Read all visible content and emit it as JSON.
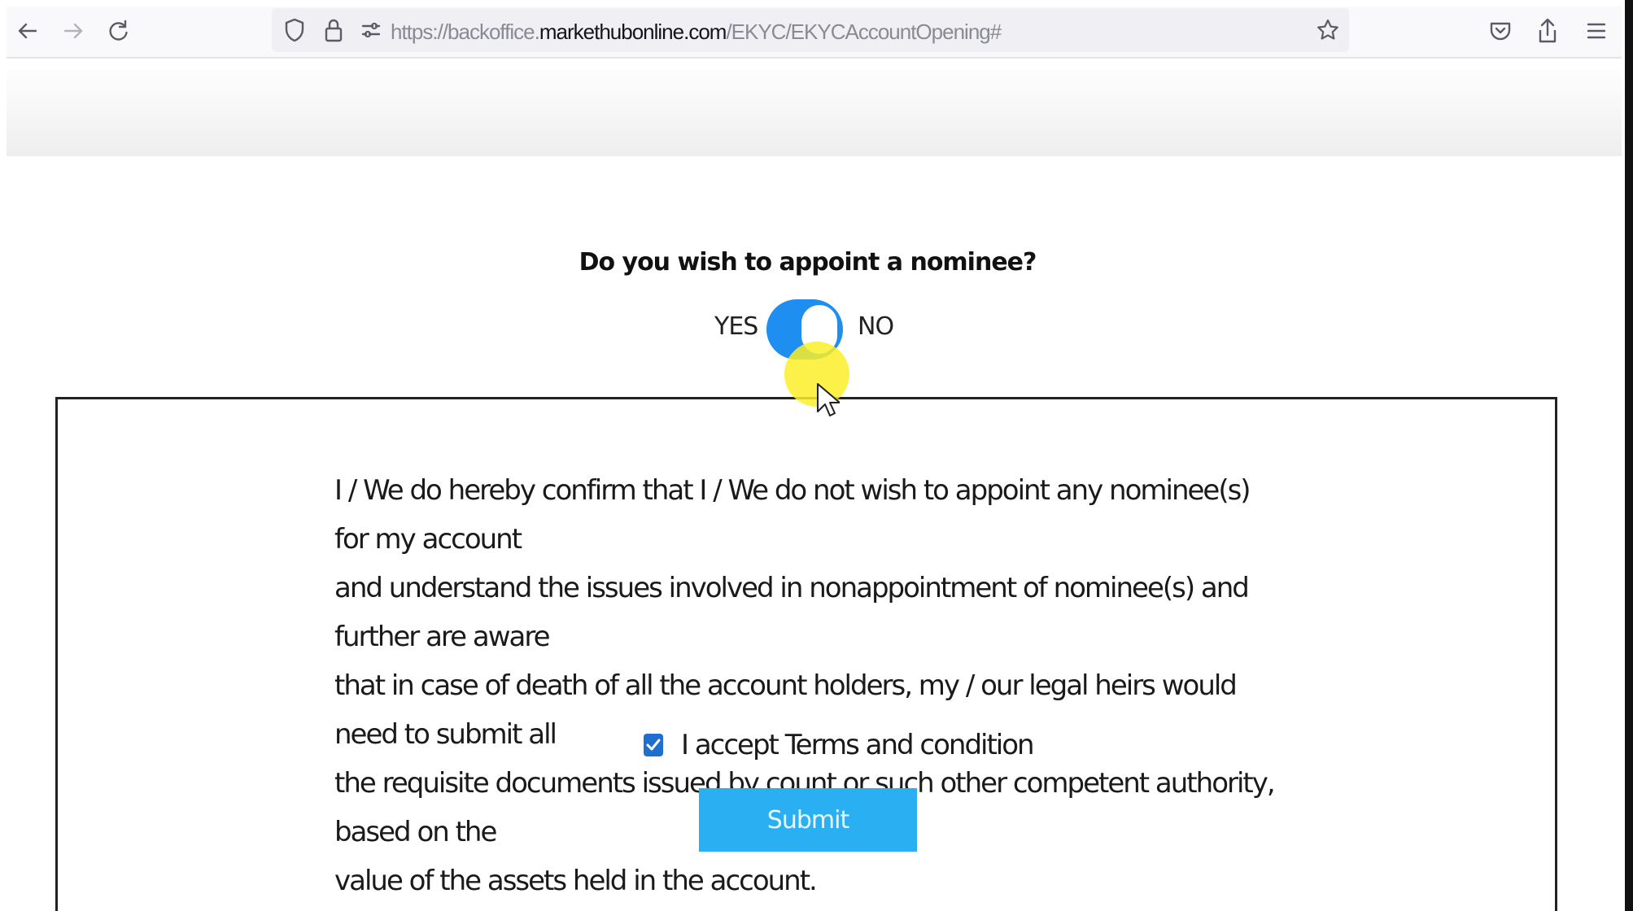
{
  "browser": {
    "url_prefix": "https://backoffice.",
    "url_domain": "markethubonline.com",
    "url_path": "/EKYC/EKYCAccountOpening#",
    "icons": [
      "back-icon",
      "forward-icon",
      "reload-icon",
      "shield-icon",
      "lock-icon",
      "permissions-icon",
      "bookmark-star-icon",
      "pocket-icon",
      "share-icon",
      "menu-icon"
    ]
  },
  "nominee": {
    "question": "Do you wish to appoint a nominee?",
    "yes_label": "YES",
    "no_label": "NO",
    "toggle_state": "NO"
  },
  "declaration": {
    "lines": [
      "I / We do hereby confirm that I / We do not wish to appoint any nominee(s) for my account",
      "and understand the issues involved in nonappointment of nominee(s) and further are aware",
      "that in case of death of all the account holders, my / our legal heirs would need to submit all",
      "the requisite documents issued by count or such other competent authority, based on the",
      "value of the assets held in the account."
    ],
    "terms_label": "I accept Terms and condition",
    "terms_checked": true,
    "submit_label": "Submit"
  },
  "colors": {
    "toggle_on": "#1e8ef0",
    "checkbox": "#1f6fd1",
    "submit_bg": "#2ab0f2",
    "cursor_highlight": "#faee28"
  }
}
